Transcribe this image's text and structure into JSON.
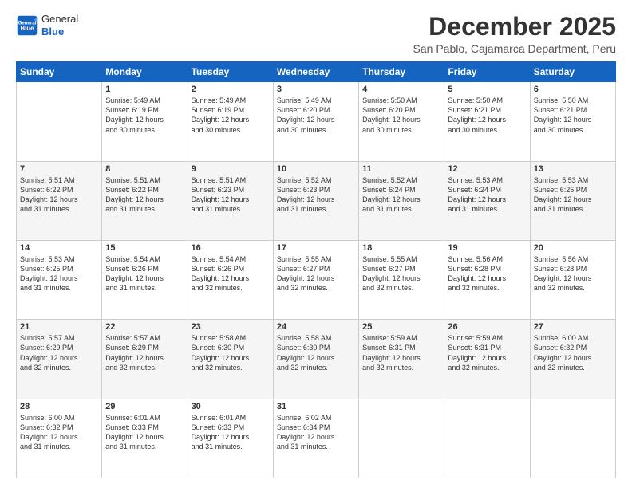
{
  "logo": {
    "general": "General",
    "blue": "Blue"
  },
  "title": "December 2025",
  "subtitle": "San Pablo, Cajamarca Department, Peru",
  "days_of_week": [
    "Sunday",
    "Monday",
    "Tuesday",
    "Wednesday",
    "Thursday",
    "Friday",
    "Saturday"
  ],
  "weeks": [
    [
      {
        "day": "",
        "info": ""
      },
      {
        "day": "1",
        "info": "Sunrise: 5:49 AM\nSunset: 6:19 PM\nDaylight: 12 hours\nand 30 minutes."
      },
      {
        "day": "2",
        "info": "Sunrise: 5:49 AM\nSunset: 6:19 PM\nDaylight: 12 hours\nand 30 minutes."
      },
      {
        "day": "3",
        "info": "Sunrise: 5:49 AM\nSunset: 6:20 PM\nDaylight: 12 hours\nand 30 minutes."
      },
      {
        "day": "4",
        "info": "Sunrise: 5:50 AM\nSunset: 6:20 PM\nDaylight: 12 hours\nand 30 minutes."
      },
      {
        "day": "5",
        "info": "Sunrise: 5:50 AM\nSunset: 6:21 PM\nDaylight: 12 hours\nand 30 minutes."
      },
      {
        "day": "6",
        "info": "Sunrise: 5:50 AM\nSunset: 6:21 PM\nDaylight: 12 hours\nand 30 minutes."
      }
    ],
    [
      {
        "day": "7",
        "info": "Sunrise: 5:51 AM\nSunset: 6:22 PM\nDaylight: 12 hours\nand 31 minutes."
      },
      {
        "day": "8",
        "info": "Sunrise: 5:51 AM\nSunset: 6:22 PM\nDaylight: 12 hours\nand 31 minutes."
      },
      {
        "day": "9",
        "info": "Sunrise: 5:51 AM\nSunset: 6:23 PM\nDaylight: 12 hours\nand 31 minutes."
      },
      {
        "day": "10",
        "info": "Sunrise: 5:52 AM\nSunset: 6:23 PM\nDaylight: 12 hours\nand 31 minutes."
      },
      {
        "day": "11",
        "info": "Sunrise: 5:52 AM\nSunset: 6:24 PM\nDaylight: 12 hours\nand 31 minutes."
      },
      {
        "day": "12",
        "info": "Sunrise: 5:53 AM\nSunset: 6:24 PM\nDaylight: 12 hours\nand 31 minutes."
      },
      {
        "day": "13",
        "info": "Sunrise: 5:53 AM\nSunset: 6:25 PM\nDaylight: 12 hours\nand 31 minutes."
      }
    ],
    [
      {
        "day": "14",
        "info": "Sunrise: 5:53 AM\nSunset: 6:25 PM\nDaylight: 12 hours\nand 31 minutes."
      },
      {
        "day": "15",
        "info": "Sunrise: 5:54 AM\nSunset: 6:26 PM\nDaylight: 12 hours\nand 31 minutes."
      },
      {
        "day": "16",
        "info": "Sunrise: 5:54 AM\nSunset: 6:26 PM\nDaylight: 12 hours\nand 32 minutes."
      },
      {
        "day": "17",
        "info": "Sunrise: 5:55 AM\nSunset: 6:27 PM\nDaylight: 12 hours\nand 32 minutes."
      },
      {
        "day": "18",
        "info": "Sunrise: 5:55 AM\nSunset: 6:27 PM\nDaylight: 12 hours\nand 32 minutes."
      },
      {
        "day": "19",
        "info": "Sunrise: 5:56 AM\nSunset: 6:28 PM\nDaylight: 12 hours\nand 32 minutes."
      },
      {
        "day": "20",
        "info": "Sunrise: 5:56 AM\nSunset: 6:28 PM\nDaylight: 12 hours\nand 32 minutes."
      }
    ],
    [
      {
        "day": "21",
        "info": "Sunrise: 5:57 AM\nSunset: 6:29 PM\nDaylight: 12 hours\nand 32 minutes."
      },
      {
        "day": "22",
        "info": "Sunrise: 5:57 AM\nSunset: 6:29 PM\nDaylight: 12 hours\nand 32 minutes."
      },
      {
        "day": "23",
        "info": "Sunrise: 5:58 AM\nSunset: 6:30 PM\nDaylight: 12 hours\nand 32 minutes."
      },
      {
        "day": "24",
        "info": "Sunrise: 5:58 AM\nSunset: 6:30 PM\nDaylight: 12 hours\nand 32 minutes."
      },
      {
        "day": "25",
        "info": "Sunrise: 5:59 AM\nSunset: 6:31 PM\nDaylight: 12 hours\nand 32 minutes."
      },
      {
        "day": "26",
        "info": "Sunrise: 5:59 AM\nSunset: 6:31 PM\nDaylight: 12 hours\nand 32 minutes."
      },
      {
        "day": "27",
        "info": "Sunrise: 6:00 AM\nSunset: 6:32 PM\nDaylight: 12 hours\nand 32 minutes."
      }
    ],
    [
      {
        "day": "28",
        "info": "Sunrise: 6:00 AM\nSunset: 6:32 PM\nDaylight: 12 hours\nand 31 minutes."
      },
      {
        "day": "29",
        "info": "Sunrise: 6:01 AM\nSunset: 6:33 PM\nDaylight: 12 hours\nand 31 minutes."
      },
      {
        "day": "30",
        "info": "Sunrise: 6:01 AM\nSunset: 6:33 PM\nDaylight: 12 hours\nand 31 minutes."
      },
      {
        "day": "31",
        "info": "Sunrise: 6:02 AM\nSunset: 6:34 PM\nDaylight: 12 hours\nand 31 minutes."
      },
      {
        "day": "",
        "info": ""
      },
      {
        "day": "",
        "info": ""
      },
      {
        "day": "",
        "info": ""
      }
    ]
  ]
}
